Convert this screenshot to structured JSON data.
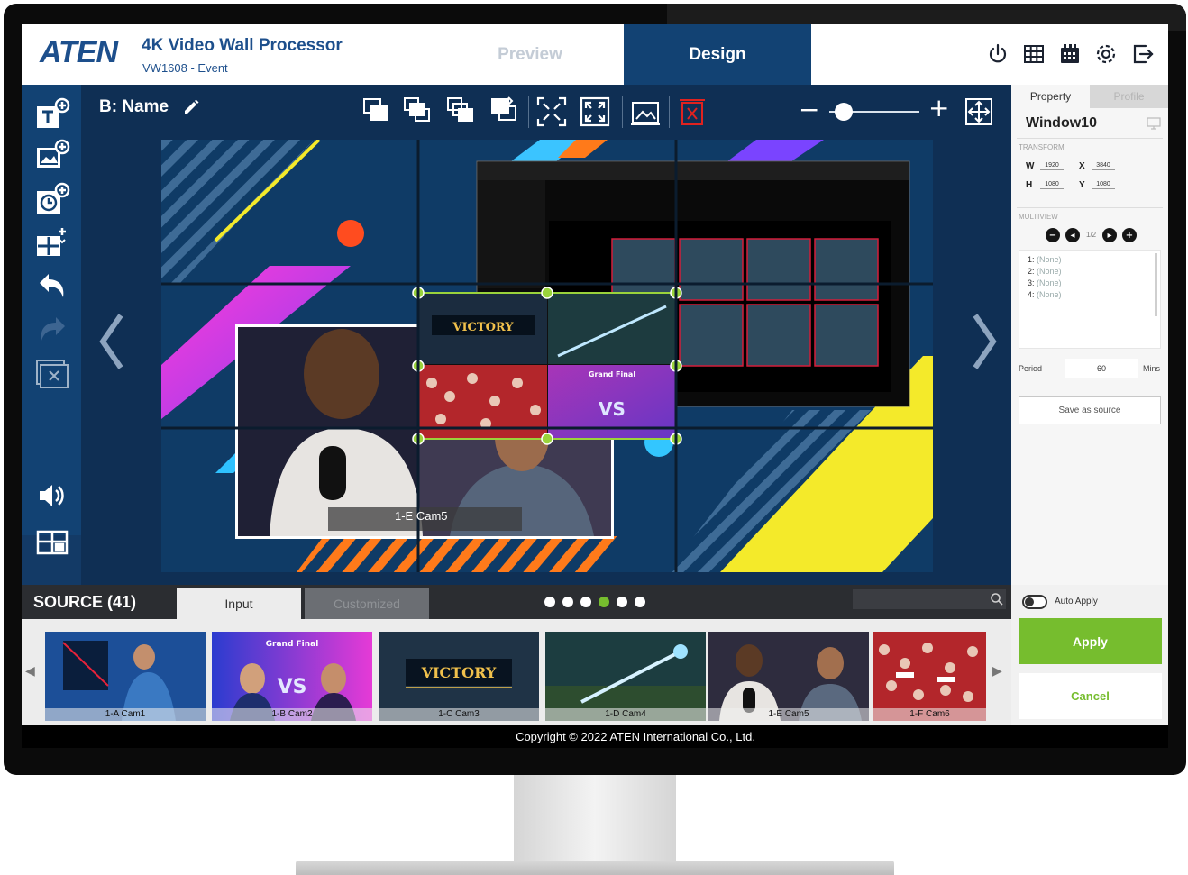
{
  "header": {
    "logo": "ATEN",
    "title": "4K Video Wall Processor",
    "subtitle": "VW1608 - Event",
    "tabs": {
      "preview": "Preview",
      "design": "Design"
    },
    "icons": [
      "power-icon",
      "grid-icon",
      "calendar-icon",
      "gear-icon",
      "logout-icon"
    ]
  },
  "left_toolbar": {
    "icons": [
      "add-text-icon",
      "add-image-icon",
      "add-clock-icon",
      "add-layout-icon",
      "undo-icon",
      "redo-icon",
      "clear-icon",
      "volume-icon",
      "wall-layout-icon"
    ]
  },
  "canvas": {
    "layout_name": "B: Name",
    "zoom_level": 0.1,
    "overlay_caption": "1-E Cam5",
    "toolbar_icons": [
      "bring-front-icon",
      "bring-forward-icon",
      "send-backward-icon",
      "send-back-icon",
      "fit-window-icon",
      "fill-window-icon",
      "background-image-icon",
      "delete-icon"
    ],
    "graphic_texts": {
      "victory": "VICTORY",
      "grand_final": "Grand Final",
      "vs": "VS"
    }
  },
  "property_panel": {
    "tabs": {
      "property": "Property",
      "profile": "Profile"
    },
    "window_name": "Window10",
    "transform_label": "TRANSFORM",
    "transform": {
      "w_label": "W",
      "w": "1920",
      "h_label": "H",
      "h": "1080",
      "x_label": "X",
      "x": "3840",
      "y_label": "Y",
      "y": "1080"
    },
    "multiview_label": "MULTIVIEW",
    "multiview_page": "1/2",
    "multiview_items": [
      {
        "index": "1:",
        "value": "(None)"
      },
      {
        "index": "2:",
        "value": "(None)"
      },
      {
        "index": "3:",
        "value": "(None)"
      },
      {
        "index": "4:",
        "value": "(None)"
      }
    ],
    "period_label": "Period",
    "period_value": "60",
    "period_unit": "Mins",
    "save_source": "Save as source"
  },
  "source": {
    "title": "SOURCE (41)",
    "tabs": {
      "input": "Input",
      "customized": "Customized"
    },
    "page_dots": 6,
    "active_dot": 4,
    "items": [
      {
        "label": "1-A Cam1"
      },
      {
        "label": "1-B Cam2"
      },
      {
        "label": "1-C Cam3"
      },
      {
        "label": "1-D Cam4"
      },
      {
        "label": "1-E Cam5"
      },
      {
        "label": "1-F Cam6"
      }
    ],
    "auto_apply": "Auto Apply",
    "apply": "Apply",
    "cancel": "Cancel"
  },
  "footer": "Copyright © 2022 ATEN International Co., Ltd.",
  "colors": {
    "brand": "#1d4f8c",
    "design_tab": "#124273",
    "accent_green": "#76bd2e"
  }
}
